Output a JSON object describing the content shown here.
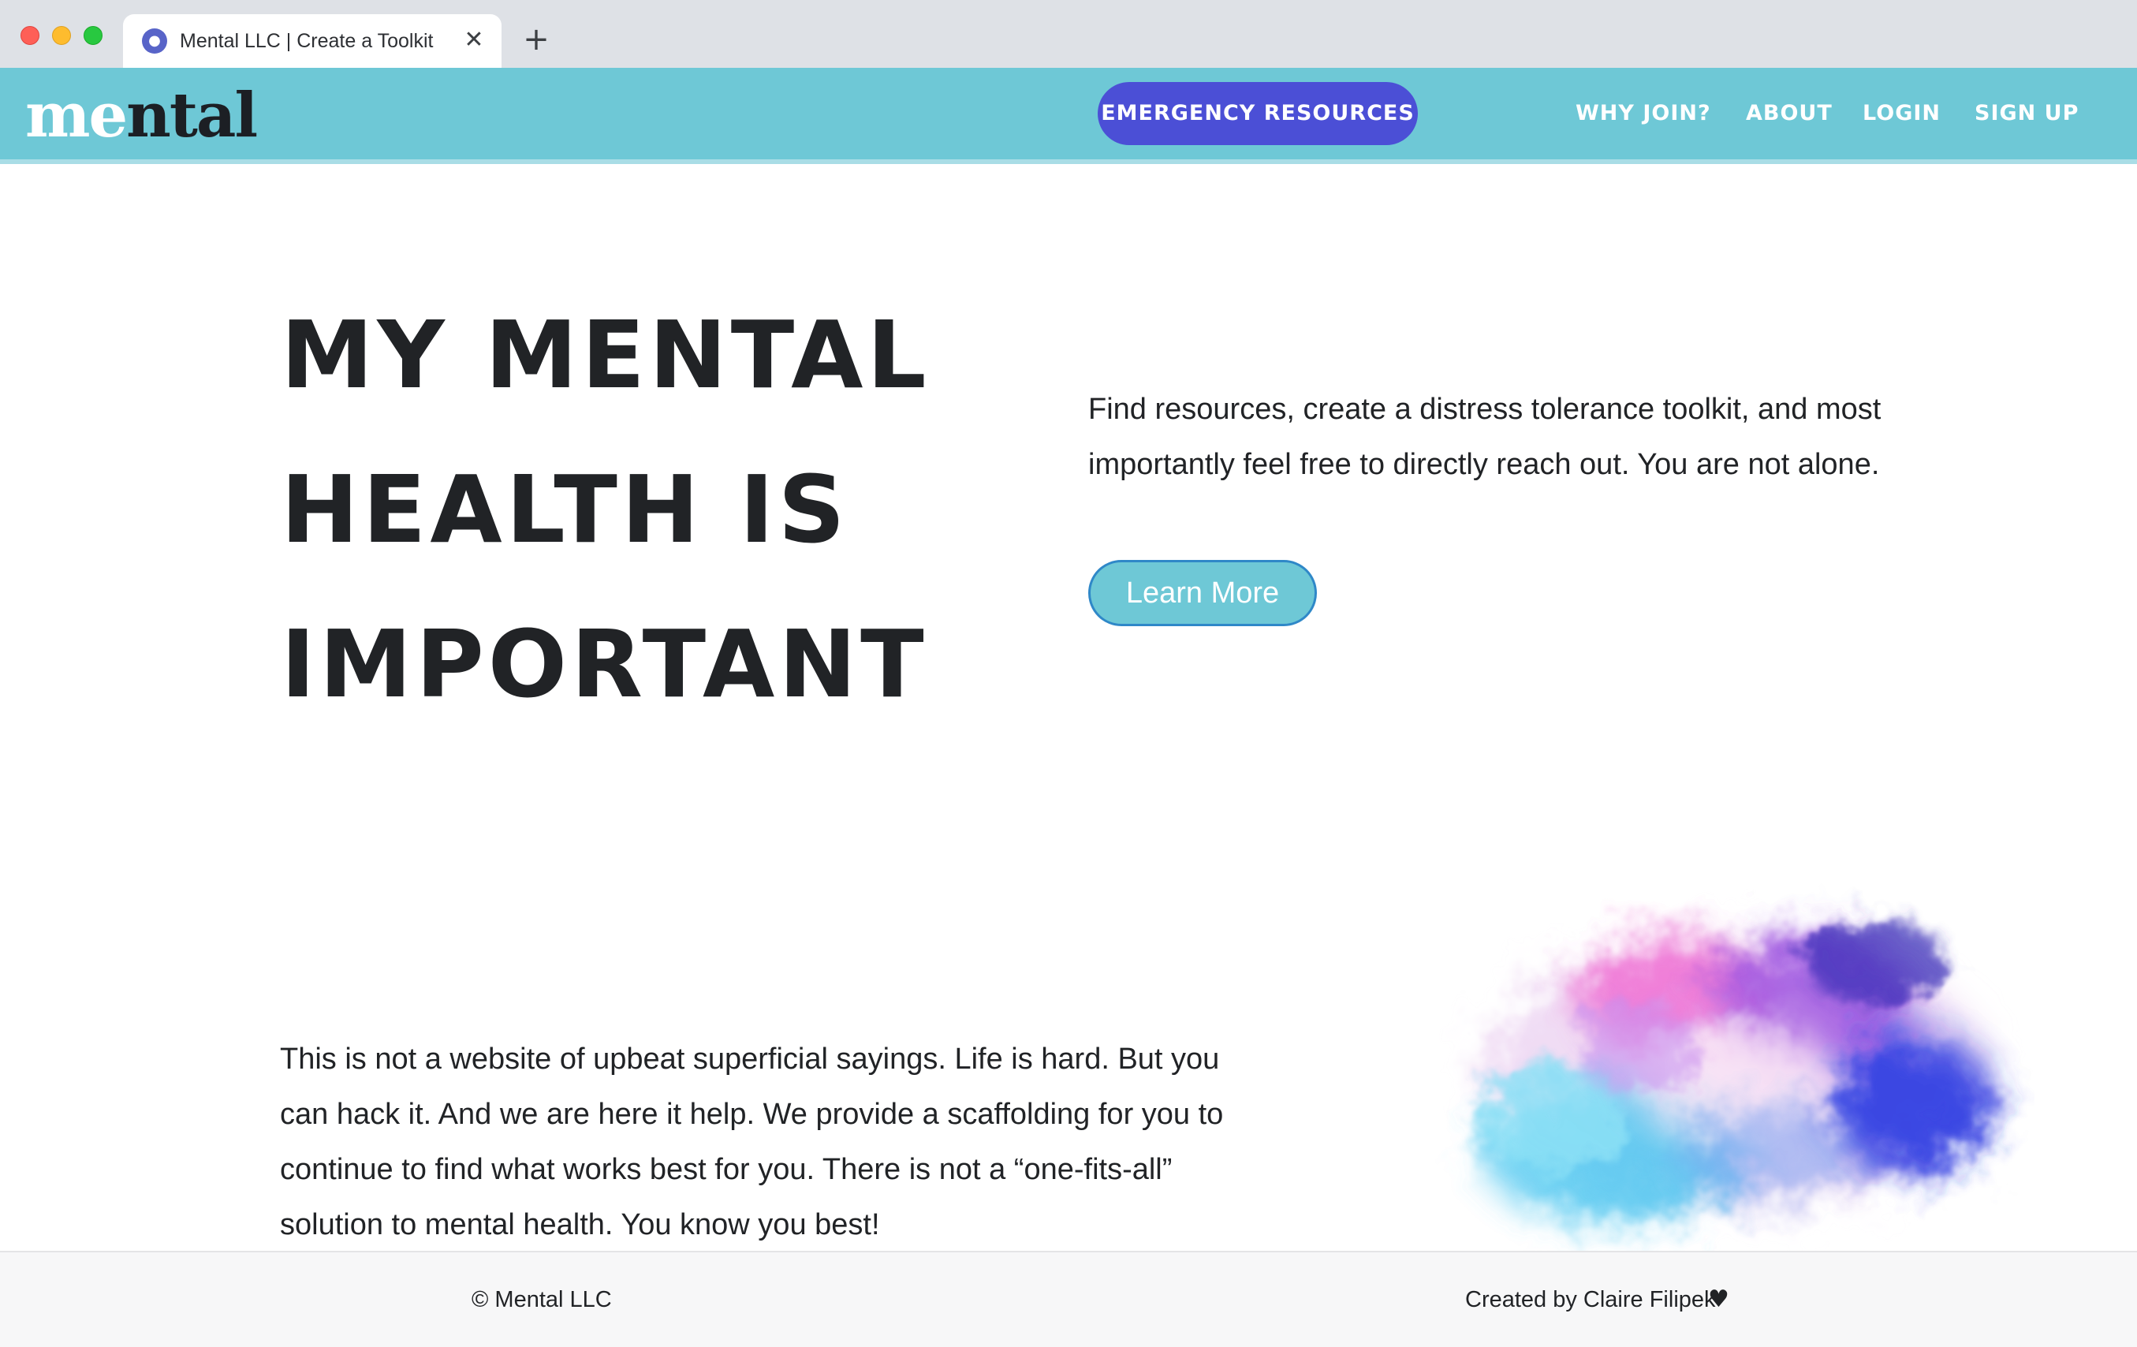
{
  "browser": {
    "tab_title": "Mental LLC | Create a Toolkit",
    "tab_favicon": "brain-icon",
    "close_icon": "close-icon",
    "new_tab_icon": "plus-icon"
  },
  "header": {
    "logo_part1": "me",
    "logo_part2": "ntal",
    "emergency_button": "EMERGENCY RESOURCES",
    "nav": {
      "why_join": "WHY JOIN?",
      "about": "ABOUT",
      "login": "LOGIN",
      "sign_up": "SIGN UP"
    },
    "colors": {
      "navbar_bg": "#6ec8d6",
      "emergency_bg": "#4b4fd6"
    }
  },
  "hero": {
    "title_lines": [
      "MY MENTAL",
      "HEALTH IS",
      "IMPORTANT"
    ],
    "description": "Find resources, create a distress tolerance toolkit, and most importantly feel free to directly reach out. You are not alone.",
    "cta_label": "Learn More"
  },
  "about": {
    "text": "This is not a website of upbeat superficial sayings. Life is hard. But you can hack it. And we are here it help. We provide a scaffolding for you to continue to find what works best for you. There is not a “one-fits-all” solution to mental health. You know you best!"
  },
  "footer": {
    "copyright": "© Mental LLC",
    "credit": "Created by Claire Filipek",
    "heart_icon": "heart-icon"
  }
}
